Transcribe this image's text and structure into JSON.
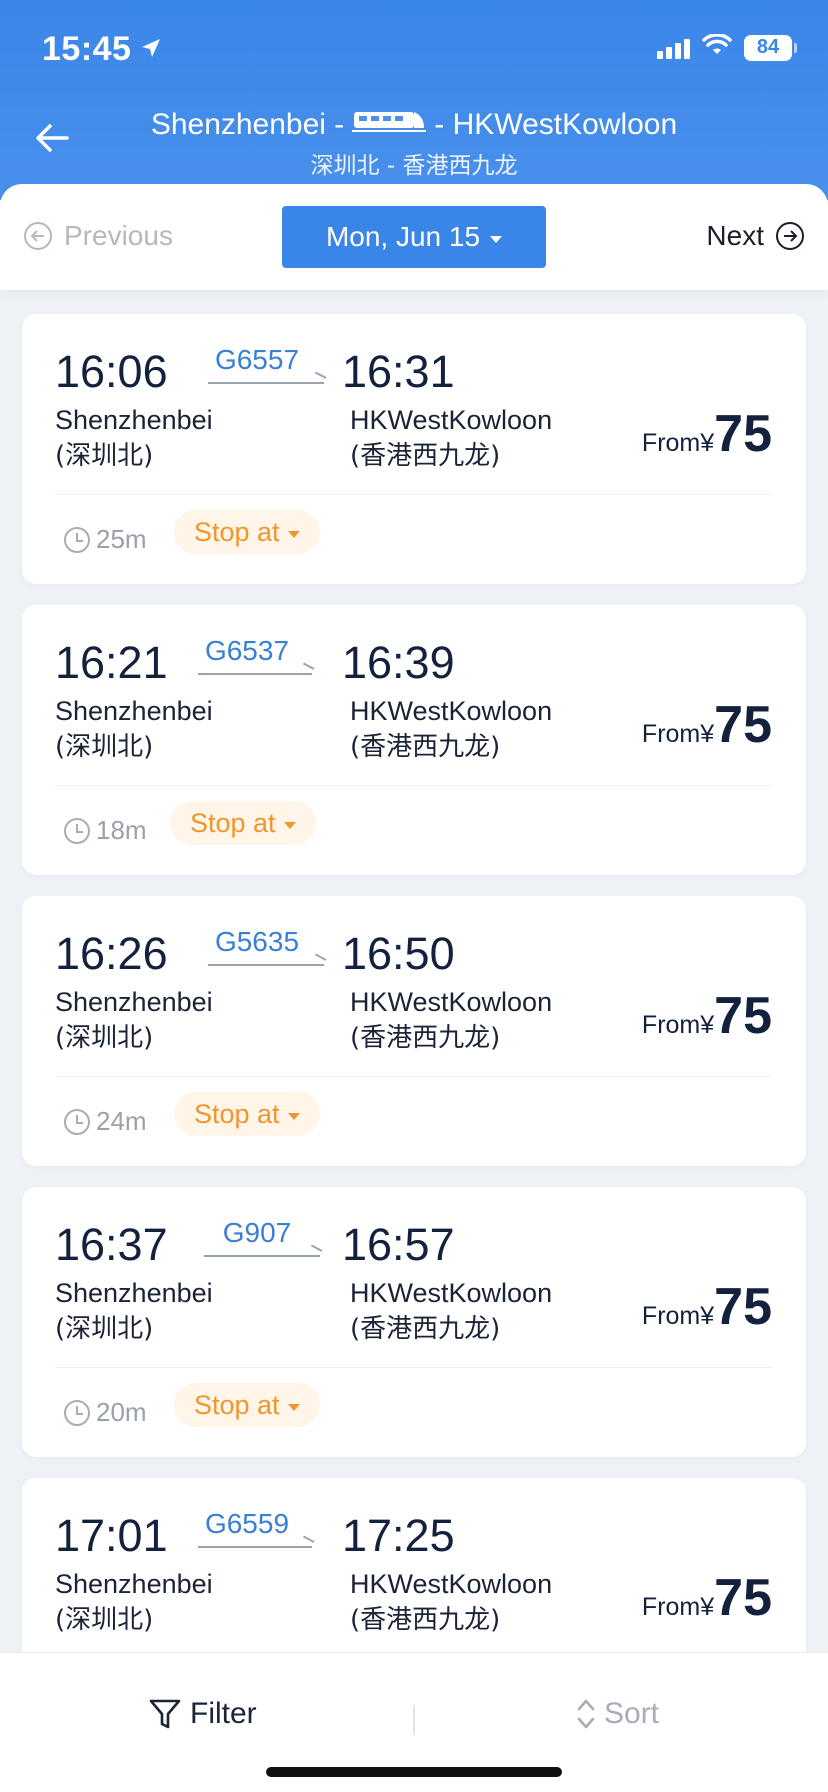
{
  "status_bar": {
    "time": "15:45",
    "battery": "84"
  },
  "header": {
    "from": "Shenzhenbei -",
    "to": "- HKWestKowloon",
    "subtitle": "深圳北 - 香港西九龙"
  },
  "date_nav": {
    "previous": "Previous",
    "date": "Mon, Jun 15",
    "next": "Next"
  },
  "trains": [
    {
      "dep_time": "16:06",
      "train_no": "G6557",
      "arr_time": "16:31",
      "dep_station": "Shenzhenbei",
      "dep_station_cn": "(深圳北)",
      "arr_station": "HKWestKowloon",
      "arr_station_cn": "(香港西九龙)",
      "from": "From",
      "currency": "¥",
      "price": "75",
      "duration": "25m",
      "stop_label": "Stop at"
    },
    {
      "dep_time": "16:21",
      "train_no": "G6537",
      "arr_time": "16:39",
      "dep_station": "Shenzhenbei",
      "dep_station_cn": "(深圳北)",
      "arr_station": "HKWestKowloon",
      "arr_station_cn": "(香港西九龙)",
      "from": "From",
      "currency": "¥",
      "price": "75",
      "duration": "18m",
      "stop_label": "Stop at"
    },
    {
      "dep_time": "16:26",
      "train_no": "G5635",
      "arr_time": "16:50",
      "dep_station": "Shenzhenbei",
      "dep_station_cn": "(深圳北)",
      "arr_station": "HKWestKowloon",
      "arr_station_cn": "(香港西九龙)",
      "from": "From",
      "currency": "¥",
      "price": "75",
      "duration": "24m",
      "stop_label": "Stop at"
    },
    {
      "dep_time": "16:37",
      "train_no": "G907",
      "arr_time": "16:57",
      "dep_station": "Shenzhenbei",
      "dep_station_cn": "(深圳北)",
      "arr_station": "HKWestKowloon",
      "arr_station_cn": "(香港西九龙)",
      "from": "From",
      "currency": "¥",
      "price": "75",
      "duration": "20m",
      "stop_label": "Stop at"
    },
    {
      "dep_time": "17:01",
      "train_no": "G6559",
      "arr_time": "17:25",
      "dep_station": "Shenzhenbei",
      "dep_station_cn": "(深圳北)",
      "arr_station": "HKWestKowloon",
      "arr_station_cn": "(香港西九龙)",
      "from": "From",
      "currency": "¥",
      "price": "75",
      "duration": "",
      "stop_label": ""
    }
  ],
  "bottom_bar": {
    "filter": "Filter",
    "sort": "Sort"
  },
  "colors": {
    "primary": "#3a86e8",
    "train_no": "#3a7fd6",
    "stop_accent": "#f0962e"
  },
  "icons": [
    "location-arrow-icon",
    "signal-icon",
    "wifi-icon",
    "battery-icon",
    "back-arrow-icon",
    "train-icon",
    "previous-circle-icon",
    "next-circle-icon",
    "clock-icon",
    "filter-icon",
    "sort-icon"
  ]
}
